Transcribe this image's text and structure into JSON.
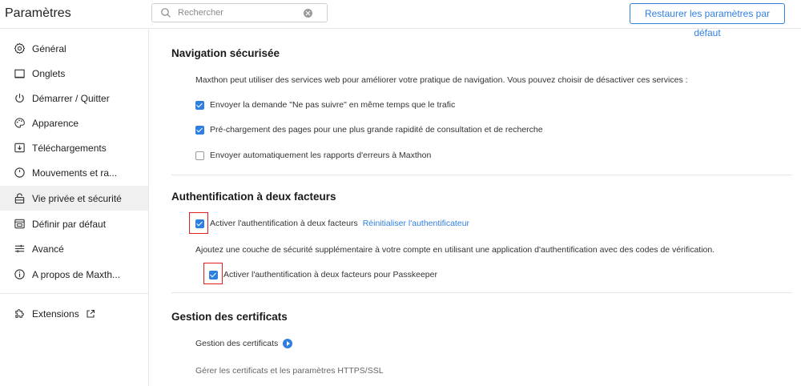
{
  "header": {
    "title": "Paramètres",
    "search_placeholder": "Rechercher",
    "restore_label": "Restaurer les paramètres par défaut"
  },
  "sidebar": {
    "items": [
      {
        "label": "Général",
        "icon": "gear-icon"
      },
      {
        "label": "Onglets",
        "icon": "tab-icon"
      },
      {
        "label": "Démarrer / Quitter",
        "icon": "power-icon"
      },
      {
        "label": "Apparence",
        "icon": "palette-icon"
      },
      {
        "label": "Téléchargements",
        "icon": "download-icon"
      },
      {
        "label": "Mouvements et ra...",
        "icon": "mouse-icon"
      },
      {
        "label": "Vie privée et sécurité",
        "icon": "lock-icon",
        "active": true
      },
      {
        "label": "Définir par défaut",
        "icon": "browser-icon"
      },
      {
        "label": "Avancé",
        "icon": "sliders-icon"
      },
      {
        "label": "A propos de Maxth...",
        "icon": "info-icon"
      }
    ],
    "extensions_label": "Extensions"
  },
  "safe_browsing": {
    "title": "Navigation sécurisée",
    "description": "Maxthon peut utiliser des services web pour améliorer votre pratique de navigation. Vous pouvez choisir de désactiver ces services :",
    "options": [
      {
        "label": "Envoyer la demande \"Ne pas suivre\" en même temps que le trafic",
        "checked": true
      },
      {
        "label": "Pré-chargement des pages pour une plus grande rapidité de consultation et de recherche",
        "checked": true
      },
      {
        "label": "Envoyer automatiquement les rapports d'erreurs à Maxthon",
        "checked": false
      }
    ]
  },
  "two_factor": {
    "title": "Authentification à deux facteurs",
    "enable_label": "Activer l'authentification à deux facteurs",
    "enable_checked": true,
    "reset_link": "Réinitialiser l'authentificateur",
    "description": "Ajoutez une couche de sécurité supplémentaire à votre compte en utilisant une application d'authentification avec des codes de vérification.",
    "passkeeper_label": "Activer l'authentification à deux facteurs pour Passkeeper",
    "passkeeper_checked": true
  },
  "certificates": {
    "title": "Gestion des certificats",
    "link_label": "Gestion des certificats",
    "description": "Gérer les certificats et les paramètres HTTPS/SSL"
  },
  "colors": {
    "accent": "#2f7fe0",
    "highlight": "#e02020"
  }
}
